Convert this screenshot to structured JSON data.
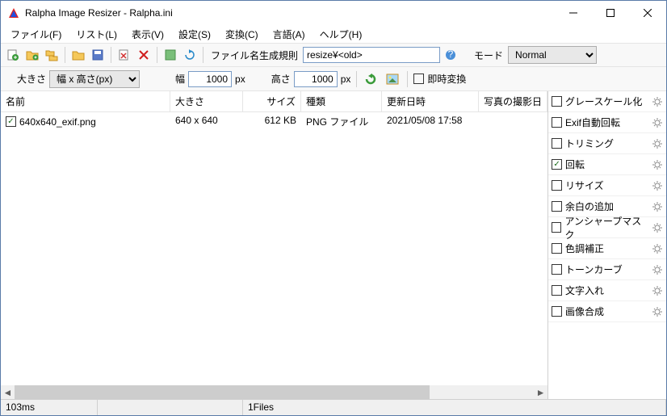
{
  "window": {
    "title": "Ralpha Image Resizer - Ralpha.ini"
  },
  "menu": [
    "ファイル(F)",
    "リスト(L)",
    "表示(V)",
    "設定(S)",
    "変換(C)",
    "言語(A)",
    "ヘルプ(H)"
  ],
  "toolbar": {
    "filename_rule_label": "ファイル名生成規則",
    "filename_rule_value": "resize¥<old>",
    "mode_label": "モード",
    "mode_value": "Normal"
  },
  "sizebar": {
    "size_label": "大きさ",
    "size_mode": "幅 x 高さ(px)",
    "width_label": "幅",
    "width_value": "1000",
    "px1": "px",
    "height_label": "高さ",
    "height_value": "1000",
    "px2": "px",
    "instant_label": "即時変換"
  },
  "columns": {
    "name": "名前",
    "size": "大きさ",
    "filesize": "サイズ",
    "type": "種類",
    "date": "更新日時",
    "shot": "写真の撮影日"
  },
  "rows": [
    {
      "checked": true,
      "name": "640x640_exif.png",
      "size": "640 x 640",
      "filesize": "612 KB",
      "type": "PNG ファイル",
      "date": "2021/05/08 17:58"
    }
  ],
  "side_items": [
    {
      "label": "グレースケール化",
      "checked": false
    },
    {
      "label": "Exif自動回転",
      "checked": false
    },
    {
      "label": "トリミング",
      "checked": false
    },
    {
      "label": "回転",
      "checked": true
    },
    {
      "label": "リサイズ",
      "checked": false
    },
    {
      "label": "余白の追加",
      "checked": false
    },
    {
      "label": "アンシャープマスク",
      "checked": false
    },
    {
      "label": "色調補正",
      "checked": false
    },
    {
      "label": "トーンカーブ",
      "checked": false
    },
    {
      "label": "文字入れ",
      "checked": false
    },
    {
      "label": "画像合成",
      "checked": false
    }
  ],
  "status": {
    "time": "103ms",
    "files": "1Files"
  }
}
